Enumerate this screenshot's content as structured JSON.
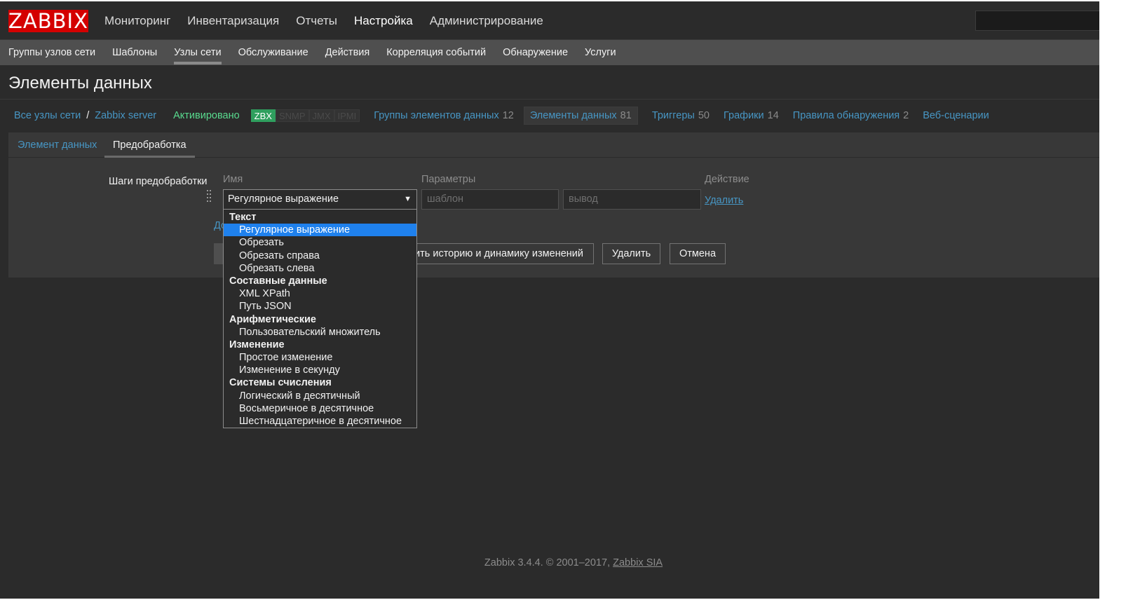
{
  "app": {
    "logo": "ZABBIX"
  },
  "top_menu": [
    "Мониторинг",
    "Инвентаризация",
    "Отчеты",
    "Настройка",
    "Администрирование"
  ],
  "sub_menu": [
    "Группы узлов сети",
    "Шаблоны",
    "Узлы сети",
    "Обслуживание",
    "Действия",
    "Корреляция событий",
    "Обнаружение",
    "Услуги"
  ],
  "page": {
    "title": "Элементы данных"
  },
  "breadcrumbs": {
    "all_hosts": "Все узлы сети",
    "separator": "/",
    "host": "Zabbix server",
    "status": "Активировано",
    "badges": [
      "ZBX",
      "SNMP",
      "JMX",
      "IPMI"
    ]
  },
  "host_tabs": {
    "item_groups": {
      "label": "Группы элементов данных",
      "count": "12"
    },
    "items": {
      "label": "Элементы данных",
      "count": "81"
    },
    "triggers": {
      "label": "Триггеры",
      "count": "50"
    },
    "graphs": {
      "label": "Графики",
      "count": "14"
    },
    "discovery": {
      "label": "Правила обнаружения",
      "count": "2"
    },
    "web": {
      "label": "Веб-сценарии"
    }
  },
  "form_tabs": {
    "item": "Элемент данных",
    "preprocessing": "Предобработка"
  },
  "form": {
    "steps_label": "Шаги предобработки",
    "col_name": "Имя",
    "col_params": "Параметры",
    "col_action": "Действие",
    "selected_step": "Регулярное выражение",
    "param1_placeholder": "шаблон",
    "param2_placeholder": "вывод",
    "remove_link": "Удалить",
    "add_link_partial": "До"
  },
  "buttons": {
    "clear_history_partial": "ить историю и динамику изменений",
    "delete": "Удалить",
    "cancel": "Отмена"
  },
  "dropdown": {
    "groups": [
      {
        "label": "Текст",
        "items": [
          "Регулярное выражение",
          "Обрезать",
          "Обрезать справа",
          "Обрезать слева"
        ]
      },
      {
        "label": "Составные данные",
        "items": [
          "XML XPath",
          "Путь JSON"
        ]
      },
      {
        "label": "Арифметические",
        "items": [
          "Пользовательский множитель"
        ]
      },
      {
        "label": "Изменение",
        "items": [
          "Простое изменение",
          "Изменение в секунду"
        ]
      },
      {
        "label": "Системы счисления",
        "items": [
          "Логический в десятичный",
          "Восьмеричное в десятичное",
          "Шестнадцатеричное в десятичное"
        ]
      }
    ],
    "highlighted": "Регулярное выражение"
  },
  "footer": {
    "text": "Zabbix 3.4.4. © 2001–2017, ",
    "link": "Zabbix SIA"
  },
  "colors": {
    "accent_link": "#4796c4",
    "logo_red": "#d40000",
    "status_green": "#59db8f",
    "highlight_blue": "#1f81ed"
  }
}
